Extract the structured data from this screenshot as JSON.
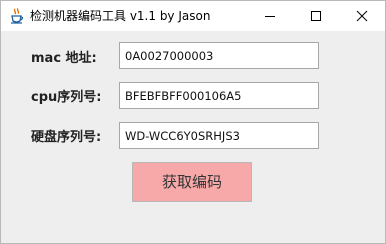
{
  "window": {
    "title": "检测机器编码工具  v1.1 by Jason",
    "icon": "java-cup-icon",
    "controls": [
      "minimize-icon",
      "maximize-icon",
      "close-icon"
    ]
  },
  "form": {
    "mac": {
      "label": "mac 地址:",
      "value": "0A0027000003"
    },
    "cpu": {
      "label": "cpu序列号:",
      "value": "BFEBFBFF000106A5"
    },
    "disk": {
      "label": "硬盘序列号:",
      "value": "WD-WCC6Y0SRHJS3"
    }
  },
  "actions": {
    "get_code_label": "获取编码",
    "get_code_color": "#f7a9a9"
  }
}
